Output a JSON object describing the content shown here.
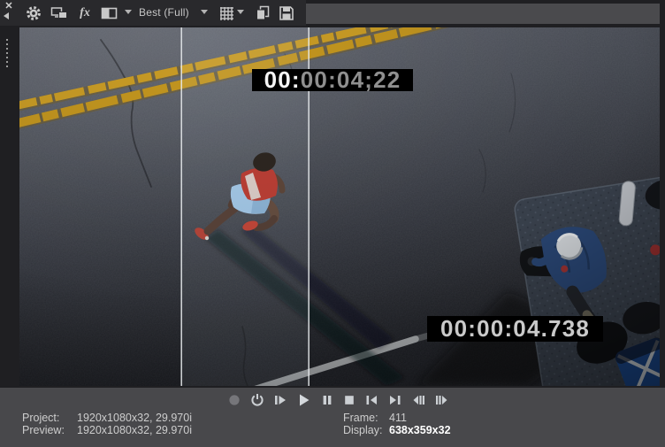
{
  "toolbar": {
    "quality_selector": {
      "label": "Best (Full)"
    },
    "icons": [
      "close-icon",
      "undock-arrow-icon",
      "gear-icon",
      "external-monitor-icon",
      "video-fx-icon",
      "split-screen-icon",
      "grid-overlay-icon",
      "copy-snapshot-icon",
      "save-snapshot-icon"
    ]
  },
  "video": {
    "timecode_top": {
      "part_bright": "00:",
      "part_dim": "00:04;22"
    },
    "timecode_bottom": "00:00:04.738"
  },
  "transport": {
    "buttons": [
      "record",
      "loop-playback",
      "play-from-start",
      "play",
      "pause",
      "stop",
      "go-to-start",
      "go-to-end",
      "previous-frame",
      "next-frame"
    ]
  },
  "status": {
    "project_label": "Project:",
    "project_value": "1920x1080x32, 29.970i",
    "preview_label": "Preview:",
    "preview_value": "1920x1080x32, 29.970i",
    "frame_label": "Frame:",
    "frame_value": "411",
    "display_label": "Display:",
    "display_value": "638x359x32"
  },
  "colors": {
    "accent_yellow": "#c89b25",
    "toolbar_bg": "#29292c",
    "panel_bg": "#48484b",
    "icon": "#c9c9c9",
    "timecode_bright": "#f4f4f4",
    "timecode_dim": "#8f8f8f"
  }
}
